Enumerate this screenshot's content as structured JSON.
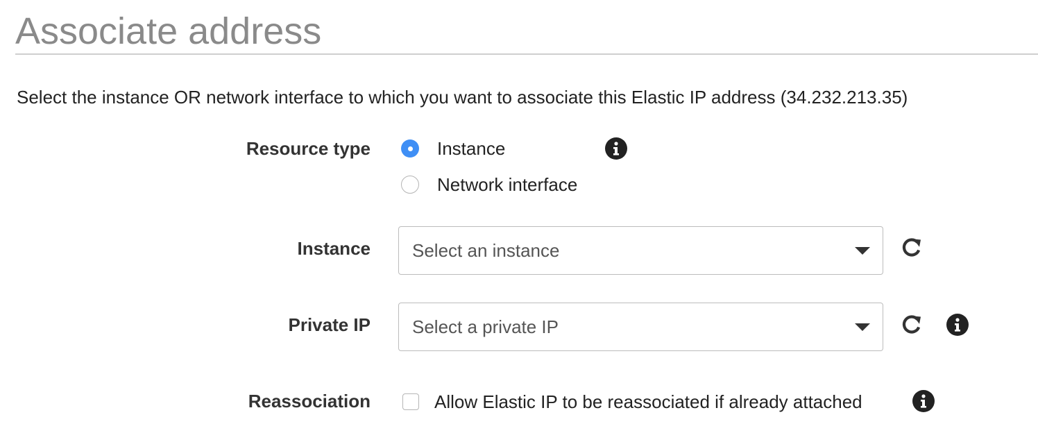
{
  "page": {
    "title": "Associate address",
    "description": "Select the instance OR network interface to which you want to associate this Elastic IP address (34.232.213.35)"
  },
  "form": {
    "resource_type": {
      "label": "Resource type",
      "options": [
        {
          "label": "Instance",
          "selected": true
        },
        {
          "label": "Network interface",
          "selected": false
        }
      ],
      "info_icon": "info-icon"
    },
    "instance": {
      "label": "Instance",
      "placeholder": "Select an instance",
      "value": "",
      "refresh_icon": "refresh-icon"
    },
    "private_ip": {
      "label": "Private IP",
      "placeholder": "Select a private IP",
      "value": "",
      "refresh_icon": "refresh-icon",
      "info_icon": "info-icon"
    },
    "reassociation": {
      "label": "Reassociation",
      "checkbox_label": "Allow Elastic IP to be reassociated if already attached",
      "checked": false,
      "info_icon": "info-icon"
    }
  },
  "colors": {
    "accent": "#3f8ff5",
    "title": "#8a8a8a",
    "text": "#222222",
    "border": "#bcbcbc"
  }
}
